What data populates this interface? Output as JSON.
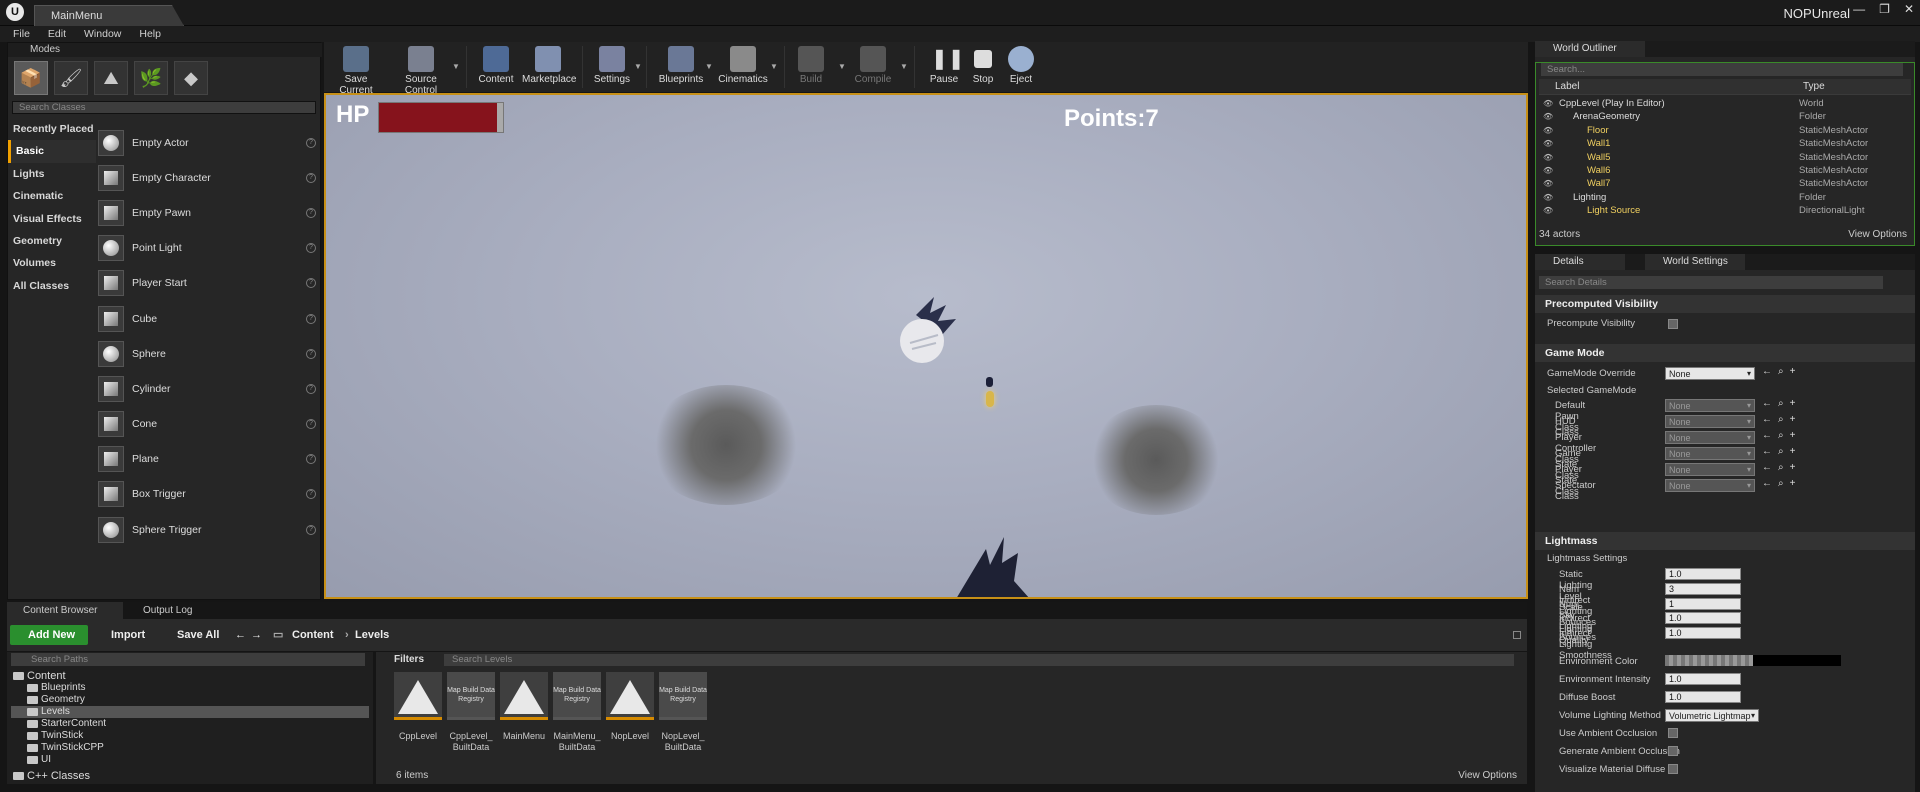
{
  "title_bar": {
    "tab_title": "MainMenu",
    "project": "NOPUnreal",
    "logo": "U"
  },
  "menu": [
    "File",
    "Edit",
    "Window",
    "Help"
  ],
  "modes": {
    "tab_label": "Modes",
    "search_placeholder": "Search Classes",
    "categories": [
      "Recently Placed",
      "Basic",
      "Lights",
      "Cinematic",
      "Visual Effects",
      "Geometry",
      "Volumes",
      "All Classes"
    ],
    "active_category": "Basic",
    "classes": [
      "Empty Actor",
      "Empty Character",
      "Empty Pawn",
      "Point Light",
      "Player Start",
      "Cube",
      "Sphere",
      "Cylinder",
      "Cone",
      "Plane",
      "Box Trigger",
      "Sphere Trigger"
    ]
  },
  "toolbar": {
    "buttons": [
      "Save Current",
      "Source Control",
      "Content",
      "Marketplace",
      "Settings",
      "Blueprints",
      "Cinematics",
      "Build",
      "Compile",
      "Pause",
      "Stop",
      "Eject"
    ]
  },
  "viewport": {
    "hp_label": "HP",
    "hp_fraction": 0.95,
    "points": "Points:7"
  },
  "content_browser": {
    "tabs": [
      "Content Browser",
      "Output Log"
    ],
    "add_new": "Add New",
    "import": "Import",
    "save_all": "Save All",
    "path": [
      "Content",
      "Levels"
    ],
    "search_paths_placeholder": "Search Paths",
    "tree": [
      "Content",
      "Blueprints",
      "Geometry",
      "Levels",
      "StarterContent",
      "TwinStick",
      "TwinStickCPP",
      "UI",
      "C++ Classes"
    ],
    "filters": "Filters",
    "search_levels_placeholder": "Search Levels",
    "assets": [
      {
        "name": "CppLevel",
        "kind": "level"
      },
      {
        "name": "CppLevel_ BuiltData",
        "kind": "map"
      },
      {
        "name": "MainMenu",
        "kind": "level"
      },
      {
        "name": "MainMenu_ BuiltData",
        "kind": "map"
      },
      {
        "name": "NopLevel",
        "kind": "level"
      },
      {
        "name": "NopLevel_ BuiltData",
        "kind": "map"
      }
    ],
    "map_build_label": "Map Build Data Registry",
    "item_count": "6 items",
    "view_options": "View Options"
  },
  "outliner": {
    "tab": "World Outliner",
    "search_placeholder": "Search...",
    "col_label": "Label",
    "col_type": "Type",
    "rows": [
      {
        "label": "CppLevel (Play In Editor)",
        "type": "World",
        "indent": 0
      },
      {
        "label": "ArenaGeometry",
        "type": "Folder",
        "indent": 1
      },
      {
        "label": "Floor",
        "type": "StaticMeshActor",
        "indent": 2
      },
      {
        "label": "Wall1",
        "type": "StaticMeshActor",
        "indent": 2
      },
      {
        "label": "Wall5",
        "type": "StaticMeshActor",
        "indent": 2
      },
      {
        "label": "Wall6",
        "type": "StaticMeshActor",
        "indent": 2
      },
      {
        "label": "Wall7",
        "type": "StaticMeshActor",
        "indent": 2
      },
      {
        "label": "Lighting",
        "type": "Folder",
        "indent": 1
      },
      {
        "label": "Light Source",
        "type": "DirectionalLight",
        "indent": 2
      }
    ],
    "actor_count": "34 actors",
    "view_options": "View Options"
  },
  "details": {
    "tabs": [
      "Details",
      "World Settings"
    ],
    "search_placeholder": "Search Details",
    "sections": {
      "precomputed": "Precomputed Visibility",
      "game_mode": "Game Mode",
      "lightmass": "Lightmass"
    },
    "precompute_visibility": "Precompute Visibility",
    "gamemode_override": "GameMode Override",
    "selected_gamemode": "Selected GameMode",
    "none": "None",
    "gm_props": [
      "Default Pawn Class",
      "HUD Class",
      "Player Controller Class",
      "Game State Class",
      "Player State Class",
      "Spectator Class"
    ],
    "lightmass_settings": "Lightmass Settings",
    "lm_props": [
      {
        "label": "Static Lighting Level Scale",
        "value": "1.0"
      },
      {
        "label": "Num Indirect Lighting Bounces",
        "value": "3"
      },
      {
        "label": "Num Sky Lighting Bounces",
        "value": "1"
      },
      {
        "label": "Indirect Lighting Quality",
        "value": "1.0"
      },
      {
        "label": "Indirect Lighting Smoothness",
        "value": "1.0"
      }
    ],
    "environment_color": "Environment Color",
    "environment_intensity": {
      "label": "Environment Intensity",
      "value": "1.0"
    },
    "diffuse_boost": {
      "label": "Diffuse Boost",
      "value": "1.0"
    },
    "volume_lighting_method": {
      "label": "Volume Lighting Method",
      "value": "Volumetric Lightmap"
    },
    "checks": [
      "Use Ambient Occlusion",
      "Generate Ambient Occlusion",
      "Visualize Material Diffuse"
    ]
  }
}
